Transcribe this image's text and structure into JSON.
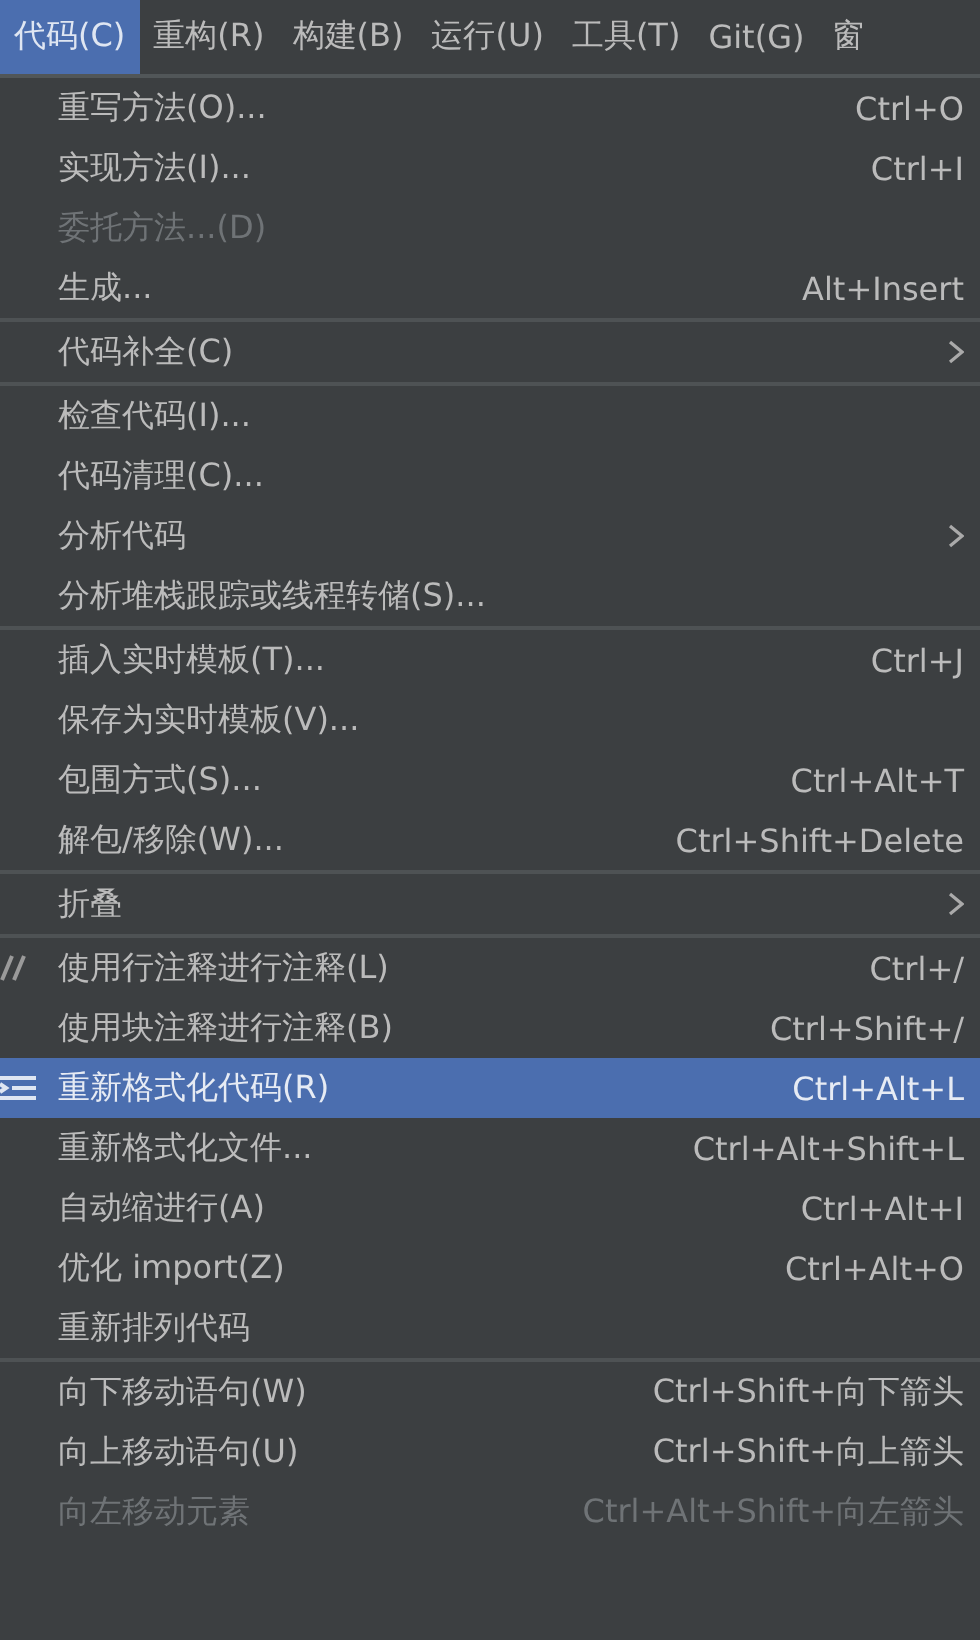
{
  "menubar": [
    {
      "label": "代码(C)",
      "selected": true
    },
    {
      "label": "重构(R)",
      "selected": false
    },
    {
      "label": "构建(B)",
      "selected": false
    },
    {
      "label": "运行(U)",
      "selected": false
    },
    {
      "label": "工具(T)",
      "selected": false
    },
    {
      "label": "Git(G)",
      "selected": false
    },
    {
      "label": "窗",
      "selected": false
    }
  ],
  "menu_groups": [
    [
      {
        "kind": "plain",
        "label": "重写方法(O)...",
        "shortcut": "Ctrl+O",
        "disabled": false,
        "selected": false,
        "submenu": false
      },
      {
        "kind": "plain",
        "label": "实现方法(I)...",
        "shortcut": "Ctrl+I",
        "disabled": false,
        "selected": false,
        "submenu": false
      },
      {
        "kind": "plain",
        "label": "委托方法...(D)",
        "disabled": true,
        "selected": false,
        "submenu": false
      },
      {
        "kind": "plain",
        "label": "生成...",
        "shortcut": "Alt+Insert",
        "disabled": false,
        "selected": false,
        "submenu": false
      }
    ],
    [
      {
        "kind": "plain",
        "label": "代码补全(C)",
        "disabled": false,
        "selected": false,
        "submenu": true
      }
    ],
    [
      {
        "kind": "plain",
        "label": "检查代码(I)...",
        "disabled": false,
        "selected": false,
        "submenu": false
      },
      {
        "kind": "plain",
        "label": "代码清理(C)...",
        "disabled": false,
        "selected": false,
        "submenu": false
      },
      {
        "kind": "plain",
        "label": "分析代码",
        "disabled": false,
        "selected": false,
        "submenu": true
      },
      {
        "kind": "plain",
        "label": "分析堆栈跟踪或线程转储(S)...",
        "disabled": false,
        "selected": false,
        "submenu": false
      }
    ],
    [
      {
        "kind": "plain",
        "label": "插入实时模板(T)...",
        "shortcut": "Ctrl+J",
        "disabled": false,
        "selected": false,
        "submenu": false
      },
      {
        "kind": "plain",
        "label": "保存为实时模板(V)...",
        "disabled": false,
        "selected": false,
        "submenu": false
      },
      {
        "kind": "plain",
        "label": "包围方式(S)...",
        "shortcut": "Ctrl+Alt+T",
        "disabled": false,
        "selected": false,
        "submenu": false
      },
      {
        "kind": "plain",
        "label": "解包/移除(W)...",
        "shortcut": "Ctrl+Shift+Delete",
        "disabled": false,
        "selected": false,
        "submenu": false
      }
    ],
    [
      {
        "kind": "plain",
        "label": "折叠",
        "disabled": false,
        "selected": false,
        "submenu": true
      }
    ],
    [
      {
        "kind": "comment",
        "label": "使用行注释进行注释(L)",
        "shortcut": "Ctrl+/",
        "disabled": false,
        "selected": false,
        "submenu": false
      },
      {
        "kind": "plain",
        "label": "使用块注释进行注释(B)",
        "shortcut": "Ctrl+Shift+/",
        "disabled": false,
        "selected": false,
        "submenu": false
      },
      {
        "kind": "format",
        "label": "重新格式化代码(R)",
        "shortcut": "Ctrl+Alt+L",
        "disabled": false,
        "selected": true,
        "submenu": false
      },
      {
        "kind": "plain",
        "label": "重新格式化文件...",
        "shortcut": "Ctrl+Alt+Shift+L",
        "disabled": false,
        "selected": false,
        "submenu": false
      },
      {
        "kind": "plain",
        "label": "自动缩进行(A)",
        "shortcut": "Ctrl+Alt+I",
        "disabled": false,
        "selected": false,
        "submenu": false
      },
      {
        "kind": "plain",
        "label": "优化 import(Z)",
        "shortcut": "Ctrl+Alt+O",
        "disabled": false,
        "selected": false,
        "submenu": false
      },
      {
        "kind": "plain",
        "label": "重新排列代码",
        "disabled": false,
        "selected": false,
        "submenu": false
      }
    ],
    [
      {
        "kind": "plain",
        "label": "向下移动语句(W)",
        "shortcut": "Ctrl+Shift+向下箭头",
        "disabled": false,
        "selected": false,
        "submenu": false
      },
      {
        "kind": "plain",
        "label": "向上移动语句(U)",
        "shortcut": "Ctrl+Shift+向上箭头",
        "disabled": false,
        "selected": false,
        "submenu": false
      },
      {
        "kind": "plain",
        "label": "向左移动元素",
        "shortcut": "Ctrl+Alt+Shift+向左箭头",
        "disabled": true,
        "selected": false,
        "submenu": false
      }
    ]
  ]
}
